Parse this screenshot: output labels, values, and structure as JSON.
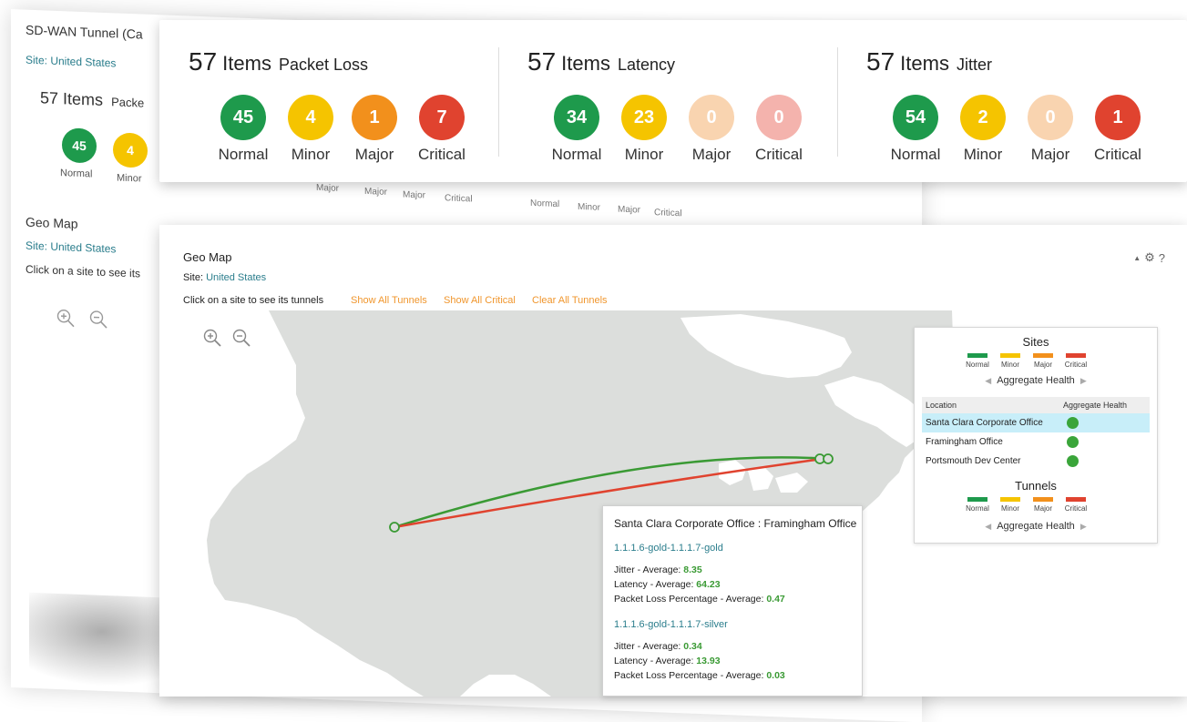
{
  "colors": {
    "normal": "#1e9a4c",
    "minor": "#f5c400",
    "major": "#f2901c",
    "critical": "#e0432f",
    "major_faded": "#f9d4b0",
    "critical_faded": "#f4b3ad",
    "link": "#f0962d",
    "site_text": "#2a7d8c",
    "map_land": "#dcdedc"
  },
  "background_panel": {
    "title": "SD-WAN Tunnel (Ca",
    "site": "Site: United States",
    "item_count": "57",
    "items_word": "Items",
    "metric_fragment": "Packe",
    "circles": [
      {
        "value": "45",
        "label": "Normal"
      },
      {
        "value": "4",
        "label": "Minor"
      }
    ],
    "ghost_labels": {
      "major": "Major",
      "critical": "Critical",
      "normal": "Normal",
      "minor": "Minor"
    },
    "geo_title": "Geo Map",
    "geo_site": "Site: United States",
    "geo_hint": "Click on a site to see its"
  },
  "metrics": [
    {
      "count": "57",
      "unit": "Items",
      "name": "Packet Loss",
      "levels": [
        {
          "value": "45",
          "label": "Normal",
          "color": "#1e9a4c"
        },
        {
          "value": "4",
          "label": "Minor",
          "color": "#f5c400"
        },
        {
          "value": "1",
          "label": "Major",
          "color": "#f2901c"
        },
        {
          "value": "7",
          "label": "Critical",
          "color": "#e0432f"
        }
      ]
    },
    {
      "count": "57",
      "unit": "Items",
      "name": "Latency",
      "levels": [
        {
          "value": "34",
          "label": "Normal",
          "color": "#1e9a4c"
        },
        {
          "value": "23",
          "label": "Minor",
          "color": "#f5c400"
        },
        {
          "value": "0",
          "label": "Major",
          "color": "#f9d4b0"
        },
        {
          "value": "0",
          "label": "Critical",
          "color": "#f4b3ad"
        }
      ]
    },
    {
      "count": "57",
      "unit": "Items",
      "name": "Jitter",
      "levels": [
        {
          "value": "54",
          "label": "Normal",
          "color": "#1e9a4c"
        },
        {
          "value": "2",
          "label": "Minor",
          "color": "#f5c400"
        },
        {
          "value": "0",
          "label": "Major",
          "color": "#f9d4b0"
        },
        {
          "value": "1",
          "label": "Critical",
          "color": "#e0432f"
        }
      ]
    }
  ],
  "geo": {
    "title": "Geo Map",
    "site_label": "Site:",
    "site_value": "United States",
    "hint": "Click on a site to see its tunnels",
    "show_all_tunnels": "Show All Tunnels",
    "show_all_critical": "Show All Critical",
    "clear_all_tunnels": "Clear All Tunnels",
    "tools": {
      "collapse": "▲",
      "settings": "⚙",
      "help": "?"
    },
    "legend": {
      "sites_title": "Sites",
      "tunnels_title": "Tunnels",
      "swatches": [
        {
          "label": "Normal",
          "color": "#1e9a4c"
        },
        {
          "label": "Minor",
          "color": "#f5c400"
        },
        {
          "label": "Major",
          "color": "#f2901c"
        },
        {
          "label": "Critical",
          "color": "#e0432f"
        }
      ],
      "aggregate_label": "Aggregate Health",
      "prev_arrow": "◀",
      "next_arrow": "▶",
      "col_location": "Location",
      "col_health": "Aggregate Health",
      "rows": [
        {
          "location": "Santa Clara Corporate Office",
          "health_color": "#3aa53a"
        },
        {
          "location": "Framingham Office",
          "health_color": "#3aa53a"
        },
        {
          "location": "Portsmouth Dev Center",
          "health_color": "#3aa53a"
        }
      ]
    },
    "tooltip": {
      "header": "Santa Clara Corporate Office : Framingham Office",
      "tunnels": [
        {
          "name": "1.1.1.6-gold-1.1.1.7-gold",
          "jitter_label": "Jitter - Average:",
          "jitter": "8.35",
          "latency_label": "Latency - Average:",
          "latency": "64.23",
          "loss_label": "Packet Loss Percentage - Average:",
          "loss": "0.47"
        },
        {
          "name": "1.1.1.6-gold-1.1.1.7-silver",
          "jitter_label": "Jitter - Average:",
          "jitter": "0.34",
          "latency_label": "Latency - Average:",
          "latency": "13.93",
          "loss_label": "Packet Loss Percentage - Average:",
          "loss": "0.03"
        }
      ]
    }
  }
}
